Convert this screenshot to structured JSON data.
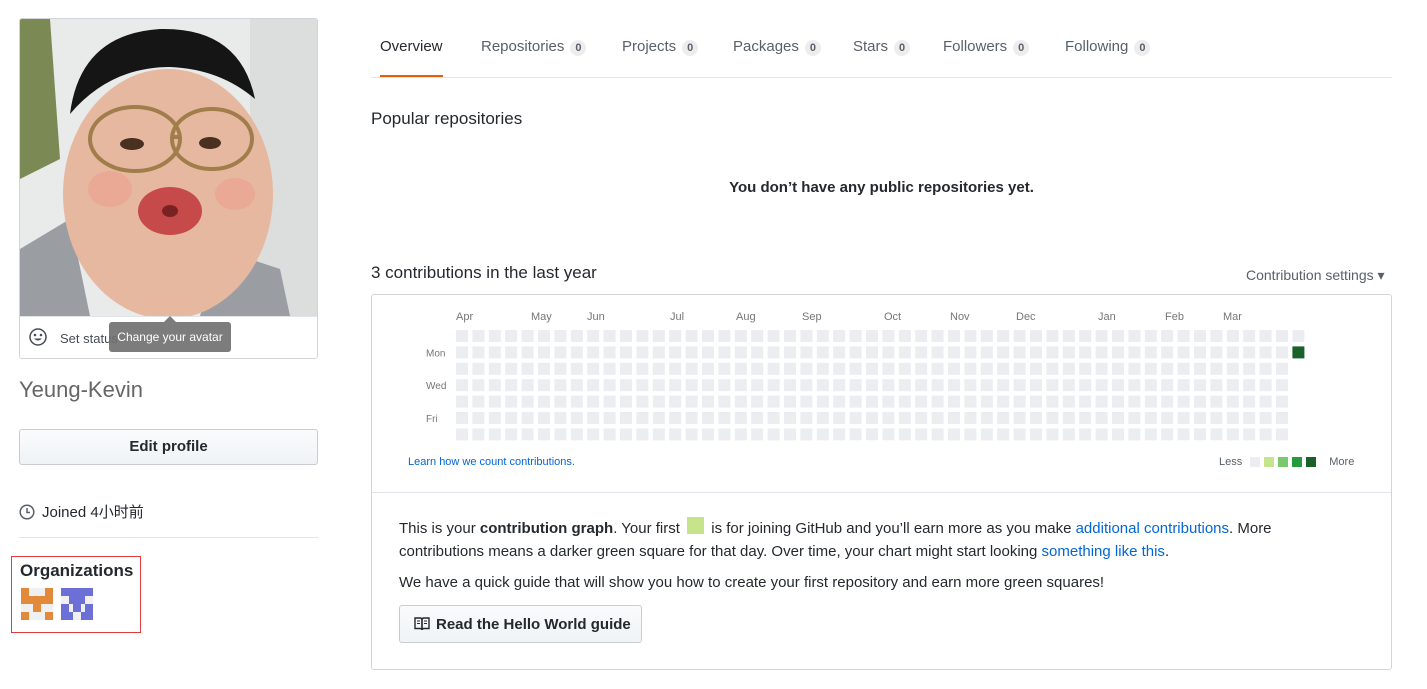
{
  "profile": {
    "set_status": "Set status",
    "tooltip": "Change your avatar",
    "username": "Yeung-Kevin",
    "edit_profile": "Edit profile",
    "joined": "Joined 4小时前",
    "organizations_title": "Organizations"
  },
  "tabs": [
    {
      "label": "Overview",
      "count": null,
      "selected": true
    },
    {
      "label": "Repositories",
      "count": "0",
      "selected": false
    },
    {
      "label": "Projects",
      "count": "0",
      "selected": false
    },
    {
      "label": "Packages",
      "count": "0",
      "selected": false
    },
    {
      "label": "Stars",
      "count": "0",
      "selected": false
    },
    {
      "label": "Followers",
      "count": "0",
      "selected": false
    },
    {
      "label": "Following",
      "count": "0",
      "selected": false
    }
  ],
  "popular": {
    "title": "Popular repositories",
    "empty_message": "You don’t have any public repositories yet."
  },
  "contributions": {
    "title": "3 contributions in the last year",
    "settings_label": "Contribution settings ▾",
    "months": [
      "Apr",
      "May",
      "Jun",
      "Jul",
      "Aug",
      "Sep",
      "Oct",
      "Nov",
      "Dec",
      "Jan",
      "Feb",
      "Mar"
    ],
    "weekday_labels": [
      "Mon",
      "Wed",
      "Fri"
    ],
    "learn_link": "Learn how we count contributions.",
    "legend_less": "Less",
    "legend_more": "More",
    "colors": [
      "#ebedf0",
      "#c6e48b",
      "#7bc96f",
      "#239a3b",
      "#196127"
    ],
    "active_day": {
      "week": 51,
      "weekday": 1,
      "level": 4
    },
    "info_part1": "This is your ",
    "info_bold": "contribution graph",
    "info_part2": ". Your first ",
    "info_part3": " is for joining GitHub and you’ll earn more as you make ",
    "info_link1": "additional contributions",
    "info_part4": ". More contributions means a darker green square for that day. Over time, your chart might start looking ",
    "info_link2": "something like this",
    "info_part5": ".",
    "guide_text": "We have a quick guide that will show you how to create your first repository and earn more green squares!",
    "guide_button": "Read the Hello World guide"
  }
}
